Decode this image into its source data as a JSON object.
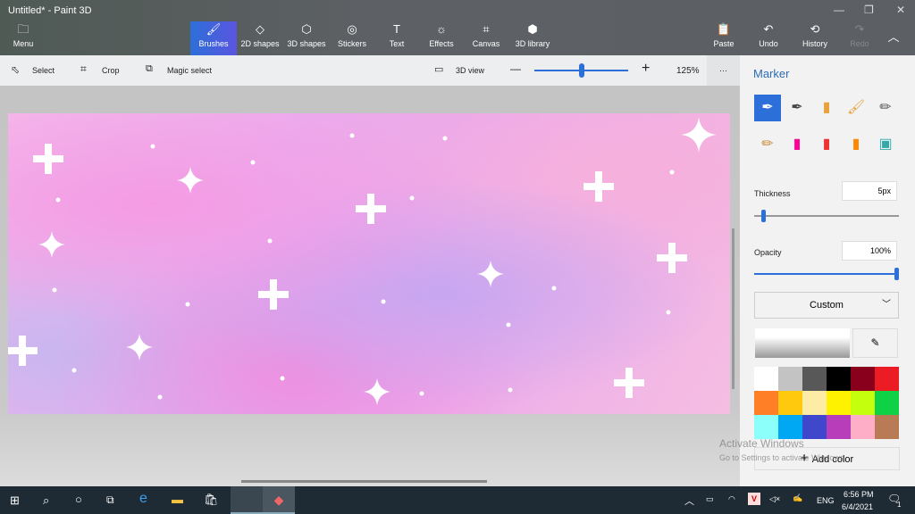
{
  "app": {
    "title": "Untitled* - Paint 3D",
    "menu": "Menu"
  },
  "tabs": [
    {
      "label": "Brushes",
      "icon": "brush-icon"
    },
    {
      "label": "2D shapes",
      "icon": "2d-shapes-icon"
    },
    {
      "label": "3D shapes",
      "icon": "cube-icon"
    },
    {
      "label": "Stickers",
      "icon": "sticker-icon"
    },
    {
      "label": "Text",
      "icon": "text-icon"
    },
    {
      "label": "Effects",
      "icon": "sun-icon"
    },
    {
      "label": "Canvas",
      "icon": "canvas-icon"
    },
    {
      "label": "3D library",
      "icon": "library-icon"
    }
  ],
  "right_actions": {
    "paste": "Paste",
    "undo": "Undo",
    "history": "History",
    "redo": "Redo"
  },
  "toolbar": {
    "select": "Select",
    "crop": "Crop",
    "magic_select": "Magic select",
    "view3d": "3D view",
    "zoom": "125%",
    "zoom_level_fraction": 0.42,
    "more": "···"
  },
  "panel": {
    "title": "Marker",
    "thickness_label": "Thickness",
    "thickness": "5px",
    "thickness_fraction": 0.05,
    "opacity_label": "Opacity",
    "opacity": "100%",
    "opacity_fraction": 1.0,
    "color_mode": "Custom",
    "add_color": "Add color",
    "brushes": [
      "marker",
      "calligraphy-pen",
      "oil-brush",
      "watercolor",
      "pixel-pen",
      "pencil",
      "eraser",
      "crayon",
      "spray-can",
      "fill"
    ],
    "palette": [
      "#ffffff",
      "#c3c3c3",
      "#585858",
      "#000000",
      "#88001b",
      "#ec1c24",
      "#ff7f27",
      "#ffc90e",
      "#fdeca6",
      "#fff200",
      "#c4ff0e",
      "#0ed145",
      "#8cfffb",
      "#00a8f3",
      "#3f48cc",
      "#b83dba",
      "#ffaec8",
      "#b97a56"
    ]
  },
  "watermark": {
    "line1": "Activate Windows",
    "line2": "Go to Settings to activate Windows."
  },
  "taskbar": {
    "lang": "ENG",
    "time": "6:56 PM",
    "date": "6/4/2021",
    "notifications": "1"
  }
}
